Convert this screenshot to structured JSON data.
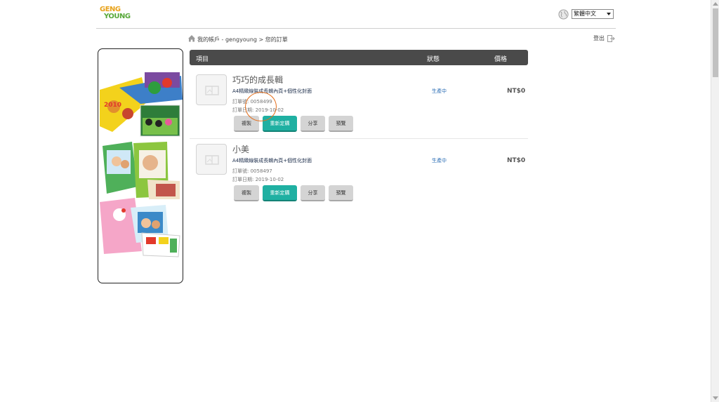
{
  "header": {
    "logo_line1": "GENG",
    "logo_line2": "YOUNG",
    "language": "繁體中文"
  },
  "breadcrumb": {
    "text": "我的帳戶 - gengyoung > 您的訂單"
  },
  "logout_label": "登出",
  "table": {
    "col_item": "項目",
    "col_status": "狀態",
    "col_price": "價格"
  },
  "orders": [
    {
      "title": "巧巧的成長輯",
      "product": "A4精緻線裝成長輯內頁+個性化封面",
      "order_no": "訂單號: 0058499",
      "order_date": "訂單日期: 2019-10-02",
      "status": "生產中",
      "price": "NT$0",
      "buttons": {
        "copy": "複製",
        "reorder": "重新定購",
        "share": "分享",
        "preview": "預覽"
      }
    },
    {
      "title": "小美",
      "product": "A4精緻線裝成長輯內頁+個性化封面",
      "order_no": "訂單號: 0058497",
      "order_date": "訂單日期: 2019-10-02",
      "status": "生產中",
      "price": "NT$0",
      "buttons": {
        "copy": "複製",
        "reorder": "重新定購",
        "share": "分享",
        "preview": "預覽"
      }
    }
  ],
  "banner": {
    "badge_text": "2010"
  },
  "colors": {
    "accent": "#1fb0a2",
    "header_bar": "#4a4a4a",
    "status": "#2a6db5",
    "annotation": "#e46f1d"
  }
}
